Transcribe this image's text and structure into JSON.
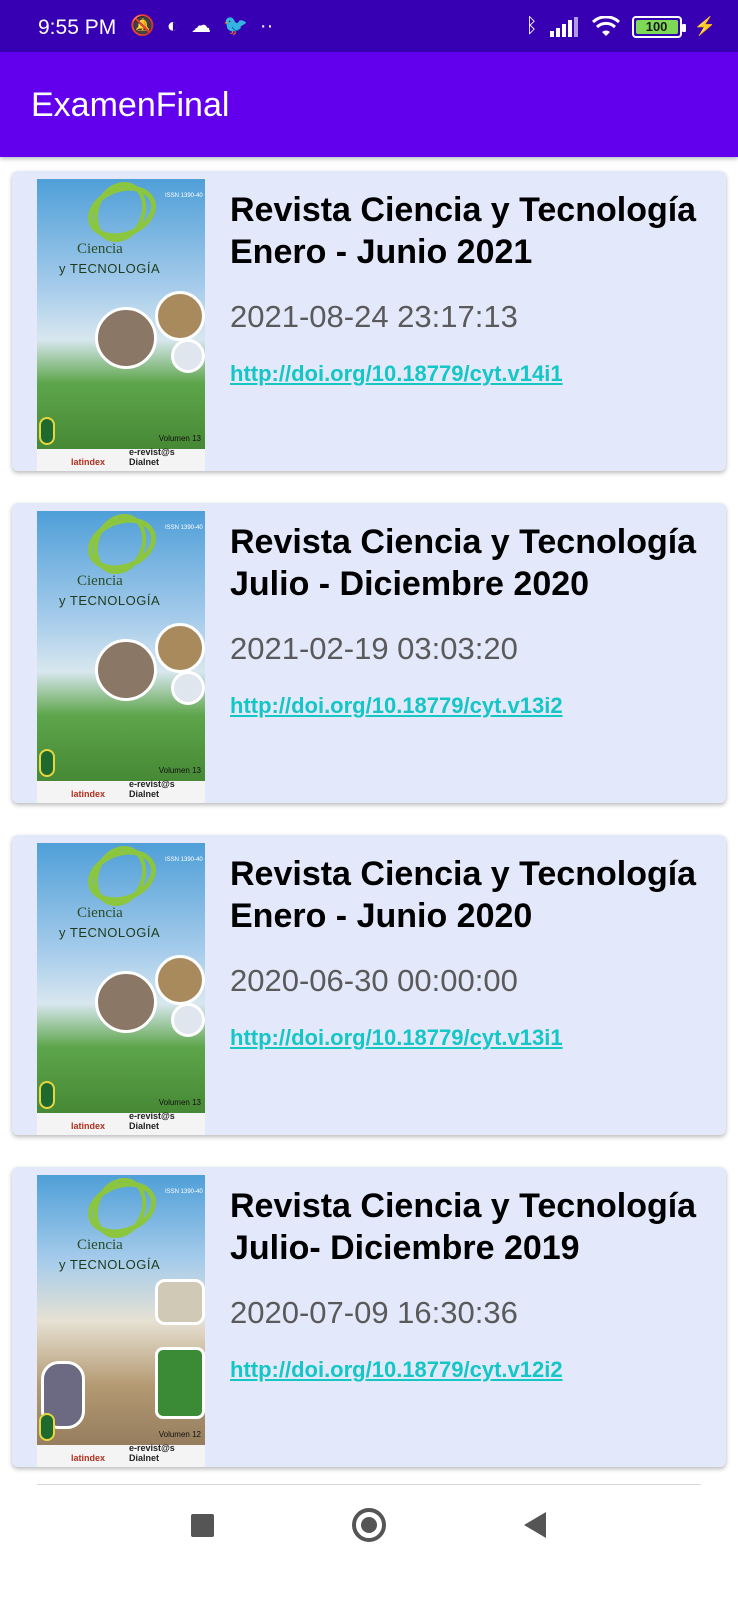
{
  "status_bar": {
    "time": "9:55 PM",
    "left_icons": [
      "muted-bell-icon",
      "data-saver-icon",
      "cloud-icon",
      "twitter-icon",
      "more-dots-icon"
    ],
    "right_icons": [
      "bluetooth-icon",
      "signal-icon",
      "wifi-icon",
      "battery-icon",
      "charging-icon"
    ],
    "battery_level": "100"
  },
  "app_bar": {
    "title": "ExamenFinal",
    "color": "#6200ee"
  },
  "items": [
    {
      "title": "Revista Ciencia y Tecnología Enero - Junio 2021",
      "date": "2021-08-24 23:17:13",
      "link": "http://doi.org/10.18779/cyt.v14i1",
      "cover": {
        "title_line1": "Ciencia",
        "title_line2": "y TECNOLOGÍA",
        "volume": "Volumen 13",
        "logo_a": "latindex",
        "logo_b": "e-revist@s Dialnet"
      }
    },
    {
      "title": "Revista Ciencia y Tecnología Julio - Diciembre 2020",
      "date": "2021-02-19 03:03:20",
      "link": "http://doi.org/10.18779/cyt.v13i2",
      "cover": {
        "title_line1": "Ciencia",
        "title_line2": "y TECNOLOGÍA",
        "volume": "Volumen 13",
        "logo_a": "latindex",
        "logo_b": "e-revist@s Dialnet"
      }
    },
    {
      "title": "Revista Ciencia y Tecnología Enero - Junio 2020",
      "date": "2020-06-30 00:00:00",
      "link": "http://doi.org/10.18779/cyt.v13i1",
      "cover": {
        "title_line1": "Ciencia",
        "title_line2": "y TECNOLOGÍA",
        "volume": "Volumen 13",
        "logo_a": "latindex",
        "logo_b": "e-revist@s Dialnet"
      }
    },
    {
      "title": "Revista Ciencia y Tecnología Julio- Diciembre 2019",
      "date": "2020-07-09 16:30:36",
      "link": "http://doi.org/10.18779/cyt.v12i2",
      "cover": {
        "title_line1": "Ciencia",
        "title_line2": "y TECNOLOGÍA",
        "volume": "Volumen 12",
        "logo_a": "latindex",
        "logo_b": "e-revist@s Dialnet"
      }
    }
  ],
  "nav_bar": {
    "icons": [
      "recents-square-icon",
      "home-circle-icon",
      "back-triangle-icon"
    ]
  }
}
